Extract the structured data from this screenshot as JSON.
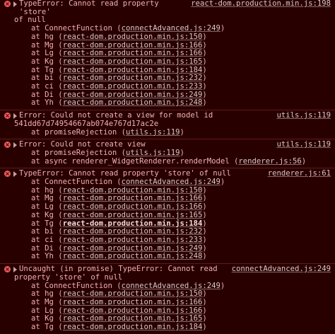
{
  "entries": [
    {
      "message": "TypeError: Cannot read property 'store'",
      "continuation": "of null",
      "source": "react-dom.production.min.js:198",
      "frames": [
        {
          "fn": "ConnectFunction",
          "link": "connectAdvanced.js:249"
        },
        {
          "fn": "hg",
          "link": "react-dom.production.min.js:150"
        },
        {
          "fn": "Mg",
          "link": "react-dom.production.min.js:166"
        },
        {
          "fn": "Lg",
          "link": "react-dom.production.min.js:166"
        },
        {
          "fn": "Kg",
          "link": "react-dom.production.min.js:165"
        },
        {
          "fn": "Tg",
          "link": "react-dom.production.min.js:184"
        },
        {
          "fn": "bi",
          "link": "react-dom.production.min.js:232"
        },
        {
          "fn": "ci",
          "link": "react-dom.production.min.js:233"
        },
        {
          "fn": "Di",
          "link": "react-dom.production.min.js:249"
        },
        {
          "fn": "Yh",
          "link": "react-dom.production.min.js:248"
        }
      ]
    },
    {
      "message": "Error: Could not create a view for model id",
      "continuation": "541dd67d74954667ab074e767d17ac2e",
      "source": "utils.js:119",
      "frames": [
        {
          "fn": "promiseRejection",
          "link": "utils.js:119"
        }
      ]
    },
    {
      "message": "Error: Could not create view",
      "continuation": "",
      "source": "utils.js:119",
      "frames": [
        {
          "fn": "promiseRejection",
          "link": "utils.js:119"
        },
        {
          "fn": "async renderer_WidgetRenderer.renderModel",
          "link": "renderer.js:56"
        }
      ]
    },
    {
      "message": "TypeError: Cannot read property 'store' of null",
      "continuation": "",
      "source": "renderer.js:61",
      "frames": [
        {
          "fn": "ConnectFunction",
          "link": "connectAdvanced.js:249"
        },
        {
          "fn": "hg",
          "link": "react-dom.production.min.js:150"
        },
        {
          "fn": "Mg",
          "link": "react-dom.production.min.js:166"
        },
        {
          "fn": "Lg",
          "link": "react-dom.production.min.js:166"
        },
        {
          "fn": "Kg",
          "link": "react-dom.production.min.js:165"
        },
        {
          "fn": "Tg",
          "link": "react-dom.production.min.js:184"
        },
        {
          "fn": "bi",
          "link": "react-dom.production.min.js:232"
        },
        {
          "fn": "ci",
          "link": "react-dom.production.min.js:233"
        },
        {
          "fn": "Di",
          "link": "react-dom.production.min.js:249"
        },
        {
          "fn": "Yh",
          "link": "react-dom.production.min.js:248"
        }
      ]
    },
    {
      "message": "Uncaught (in promise) TypeError: Cannot read",
      "continuation": "property 'store' of null",
      "source": "connectAdvanced.js:249",
      "frames": [
        {
          "fn": "ConnectFunction",
          "link": "connectAdvanced.js:249"
        },
        {
          "fn": "hg",
          "link": "react-dom.production.min.js:150"
        },
        {
          "fn": "Mg",
          "link": "react-dom.production.min.js:166"
        },
        {
          "fn": "Lg",
          "link": "react-dom.production.min.js:166"
        },
        {
          "fn": "Kg",
          "link": "react-dom.production.min.js:165"
        },
        {
          "fn": "Tg",
          "link": "react-dom.production.min.js:184"
        }
      ]
    }
  ],
  "frame_prefix": "at",
  "colors": {
    "background": "#290000",
    "error_text": "#f2b0b0",
    "link": "#d9c6c6",
    "icon": "#ef5a5a",
    "divider": "#5c1a1a"
  },
  "icons": [
    "error-icon",
    "expand-triangle-icon"
  ]
}
